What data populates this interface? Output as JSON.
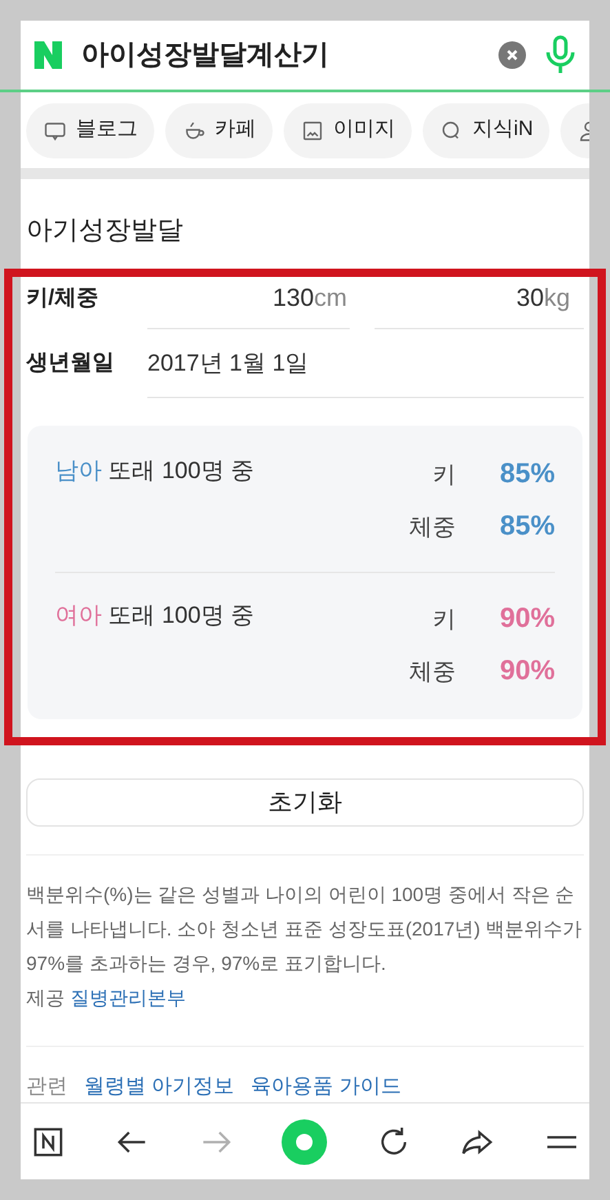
{
  "search": {
    "value": "아이성장발달계산기"
  },
  "chips": [
    {
      "kind": "blog",
      "label": "블로그"
    },
    {
      "kind": "cafe",
      "label": "카페"
    },
    {
      "kind": "image",
      "label": "이미지"
    },
    {
      "kind": "kin",
      "label": "지식iN"
    },
    {
      "kind": "person"
    }
  ],
  "calculator": {
    "title": "아기성장발달",
    "size_label": "키/체중",
    "height": {
      "value": "130",
      "unit": "cm"
    },
    "weight": {
      "value": "30",
      "unit": "kg"
    },
    "birth_label": "생년월일",
    "birth": "2017년 1월 1일",
    "results": [
      {
        "group": "남아",
        "suffix": "또래 100명 중",
        "color": "#4a90c8",
        "rows": [
          {
            "label": "키",
            "value": "85%"
          },
          {
            "label": "체중",
            "value": "85%"
          }
        ]
      },
      {
        "group": "여아",
        "suffix": "또래 100명 중",
        "color": "#e0709a",
        "rows": [
          {
            "label": "키",
            "value": "90%"
          },
          {
            "label": "체중",
            "value": "90%"
          }
        ]
      }
    ],
    "reset": "초기화"
  },
  "note": "백분위수(%)는 같은 성별과 나이의 어린이 100명 중에서 작은 순서를 나타냅니다. 소아 청소년 표준 성장도표(2017년) 백분위수가 97%를 초과하는 경우, 97%로 표기합니다.",
  "source": {
    "label": "제공",
    "link": "질병관리본부"
  },
  "related": {
    "label": "관련",
    "links": [
      "월령별 아기정보",
      "육아용품 가이드"
    ]
  },
  "toolbar": [
    {
      "kind": "home",
      "disabled": false
    },
    {
      "kind": "back",
      "disabled": false
    },
    {
      "kind": "forward",
      "disabled": true
    },
    {
      "kind": "green",
      "disabled": false
    },
    {
      "kind": "reload",
      "disabled": false
    },
    {
      "kind": "share",
      "disabled": false
    },
    {
      "kind": "menu",
      "disabled": false
    }
  ]
}
